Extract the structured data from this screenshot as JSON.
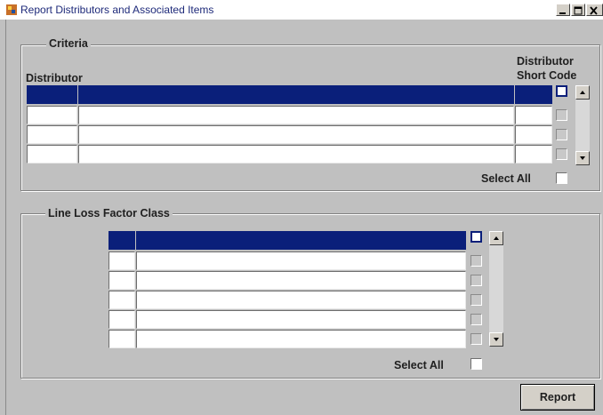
{
  "window": {
    "title": "Report Distributors and Associated Items"
  },
  "criteria": {
    "legend": "Criteria",
    "col_distributor": "Distributor",
    "col_short_code_line1": "Distributor",
    "col_short_code_line2": "Short Code",
    "select_all_label": "Select All"
  },
  "llf": {
    "legend": "Line Loss Factor Class",
    "select_all_label": "Select All"
  },
  "buttons": {
    "report": "Report"
  },
  "colors": {
    "selection": "#0a1f7a",
    "background": "#c0c0c0",
    "title_text": "#1e2a7a"
  }
}
